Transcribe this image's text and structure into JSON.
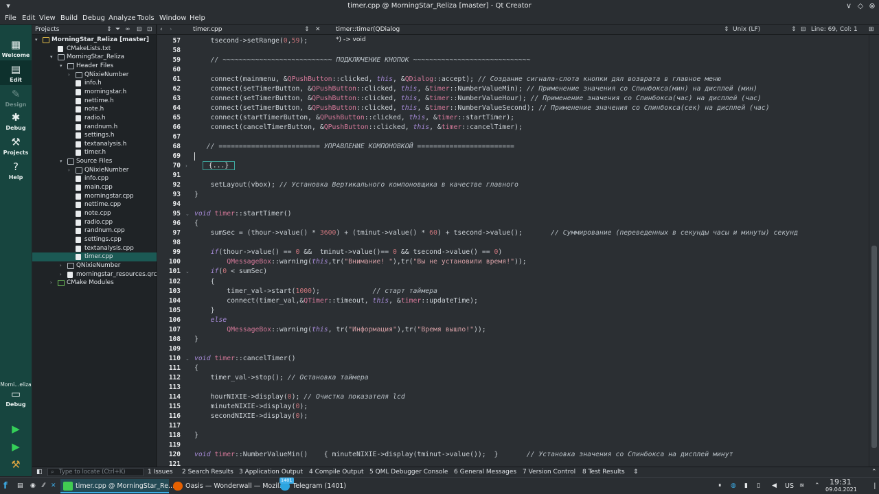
{
  "window": {
    "title": "timer.cpp @ MorningStar_Reliza [master] - Qt Creator"
  },
  "menu": [
    "File",
    "Edit",
    "View",
    "Build",
    "Debug",
    "Analyze",
    "Tools",
    "Window",
    "Help"
  ],
  "modes": [
    {
      "label": "Welcome"
    },
    {
      "label": "Edit"
    },
    {
      "label": "Design"
    },
    {
      "label": "Debug"
    },
    {
      "label": "Projects"
    },
    {
      "label": "Help"
    }
  ],
  "kit": {
    "project": "Morni...eliza",
    "label": "Debug"
  },
  "projects": {
    "header": "Projects",
    "tree": [
      {
        "label": "MorningStar_Reliza [master]",
        "bold": true
      },
      {
        "label": "CMakeLists.txt"
      },
      {
        "label": "MorningStar_Reliza"
      },
      {
        "label": "Header Files"
      },
      {
        "label": "QNixieNumber"
      },
      {
        "label": "info.h"
      },
      {
        "label": "morningstar.h"
      },
      {
        "label": "nettime.h"
      },
      {
        "label": "note.h"
      },
      {
        "label": "radio.h"
      },
      {
        "label": "randnum.h"
      },
      {
        "label": "settings.h"
      },
      {
        "label": "textanalysis.h"
      },
      {
        "label": "timer.h"
      },
      {
        "label": "Source Files"
      },
      {
        "label": "QNixieNumber"
      },
      {
        "label": "info.cpp"
      },
      {
        "label": "main.cpp"
      },
      {
        "label": "morningstar.cpp"
      },
      {
        "label": "nettime.cpp"
      },
      {
        "label": "note.cpp"
      },
      {
        "label": "radio.cpp"
      },
      {
        "label": "randnum.cpp"
      },
      {
        "label": "settings.cpp"
      },
      {
        "label": "textanalysis.cpp"
      },
      {
        "label": "timer.cpp"
      },
      {
        "label": "QNixieNumber"
      },
      {
        "label": "morningstar_resources.qrc"
      },
      {
        "label": "CMake Modules"
      }
    ]
  },
  "editor": {
    "file": "timer.cpp",
    "symbol": "timer::timer(QDialog *) -> void",
    "encoding": "Unix (LF)",
    "position": "Line: 69, Col: 1",
    "lines": [
      {
        "n": "57",
        "t": "    tsecond->setRange(0,59);"
      },
      {
        "n": "58",
        "t": ""
      },
      {
        "n": "59",
        "t": "    // ~~~~~~~~~~~~~~~~~~~~~~~~~~~ ПОДКЛЮЧЕНИЕ КНОПОК ~~~~~~~~~~~~~~~~~~~~~~~~~~~~~"
      },
      {
        "n": "60",
        "t": ""
      },
      {
        "n": "61",
        "t": "    connect(mainmenu, &QPushButton::clicked, this, &QDialog::accept); // Создание сигнала-слота кнопки дял возврата в главное меню"
      },
      {
        "n": "62",
        "t": "    connect(setTimerButton, &QPushButton::clicked, this, &timer::NumberValueMin); // Применение значения со Спинбокса(мин) на дисплей (мин)"
      },
      {
        "n": "63",
        "t": "    connect(setTimerButton, &QPushButton::clicked, this, &timer::NumberValueHour); // Применение значения со Спинбокса(час) на дисплей (час)"
      },
      {
        "n": "64",
        "t": "    connect(setTimerButton, &QPushButton::clicked, this, &timer::NumberValueSecond); // Применение значения со Спинбокса(сек) на дисплей (час)"
      },
      {
        "n": "65",
        "t": "    connect(startTimerButton, &QPushButton::clicked, this, &timer::startTimer);"
      },
      {
        "n": "66",
        "t": "    connect(cancelTimerButton, &QPushButton::clicked, this, &timer::cancelTimer);"
      },
      {
        "n": "67",
        "t": ""
      },
      {
        "n": "68",
        "t": "   // ========================= УПРАВЛЕНИЕ КОМПОНОВКОЙ ========================"
      },
      {
        "n": "69",
        "t": ""
      },
      {
        "n": "70",
        "t": "  {...}"
      },
      {
        "n": "91",
        "t": ""
      },
      {
        "n": "92",
        "t": "    setLayout(vbox); // Установка Вертикального компоновщика в качестве главного"
      },
      {
        "n": "93",
        "t": "}"
      },
      {
        "n": "94",
        "t": ""
      },
      {
        "n": "95",
        "t": "void timer::startTimer()"
      },
      {
        "n": "96",
        "t": "{"
      },
      {
        "n": "97",
        "t": "    sumSec = (thour->value() * 3600) + (tminut->value() * 60) + tsecond->value();       // Суммирование (переведенных в секунды часы и минуты) секунд"
      },
      {
        "n": "98",
        "t": ""
      },
      {
        "n": "99",
        "t": "    if(thour->value() == 0 &&  tminut->value()== 0 && tsecond->value() == 0)"
      },
      {
        "n": "100",
        "t": "        QMessageBox::warning(this,tr(\"Внимание! \"),tr(\"Вы не установили время!\"));"
      },
      {
        "n": "101",
        "t": "    if(0 < sumSec)"
      },
      {
        "n": "102",
        "t": "    {"
      },
      {
        "n": "103",
        "t": "        timer_val->start(1000);             // старт таймера"
      },
      {
        "n": "104",
        "t": "        connect(timer_val,&QTimer::timeout, this, &timer::updateTime);"
      },
      {
        "n": "105",
        "t": "    }"
      },
      {
        "n": "106",
        "t": "    else"
      },
      {
        "n": "107",
        "t": "        QMessageBox::warning(this, tr(\"Информация\"),tr(\"Время вышло!\"));"
      },
      {
        "n": "108",
        "t": "}"
      },
      {
        "n": "109",
        "t": ""
      },
      {
        "n": "110",
        "t": "void timer::cancelTimer()"
      },
      {
        "n": "111",
        "t": "{"
      },
      {
        "n": "112",
        "t": "    timer_val->stop(); // Остановка таймера"
      },
      {
        "n": "113",
        "t": ""
      },
      {
        "n": "114",
        "t": "    hourNIXIE->display(0); // Очистка показателя lcd"
      },
      {
        "n": "115",
        "t": "    minuteNIXIE->display(0);"
      },
      {
        "n": "116",
        "t": "    secondNIXIE->display(0);"
      },
      {
        "n": "117",
        "t": ""
      },
      {
        "n": "118",
        "t": "}"
      },
      {
        "n": "119",
        "t": ""
      },
      {
        "n": "120",
        "t": "void timer::NumberValueMin()    { minuteNIXIE->display(tminut->value());  }       // Установка значения со Спинбокса на дисплей минут"
      },
      {
        "n": "121",
        "t": ""
      }
    ]
  },
  "locator": {
    "placeholder": "Type to locate (Ctrl+K)"
  },
  "output_panes": [
    "1 Issues",
    "2 Search Results",
    "3 Application Output",
    "4 Compile Output",
    "5 QML Debugger Console",
    "6 General Messages",
    "7 Version Control",
    "8 Test Results"
  ],
  "taskbar": {
    "tasks": [
      {
        "label": "timer.cpp @ MorningStar_Re...",
        "active": true
      },
      {
        "label": "Oasis — Wonderwall — Mozil..."
      },
      {
        "label": "Telegram (1401)"
      }
    ],
    "badge": "1401",
    "keyboard": "US",
    "time": "19:31",
    "date": "09.04.2021"
  },
  "colors": {
    "modebar": "#17453f",
    "selection": "#1b5954",
    "editor_bg": "#2b2f33",
    "keyword": "#a78bd8",
    "number": "#c9747b",
    "string": "#d7a0a6"
  }
}
